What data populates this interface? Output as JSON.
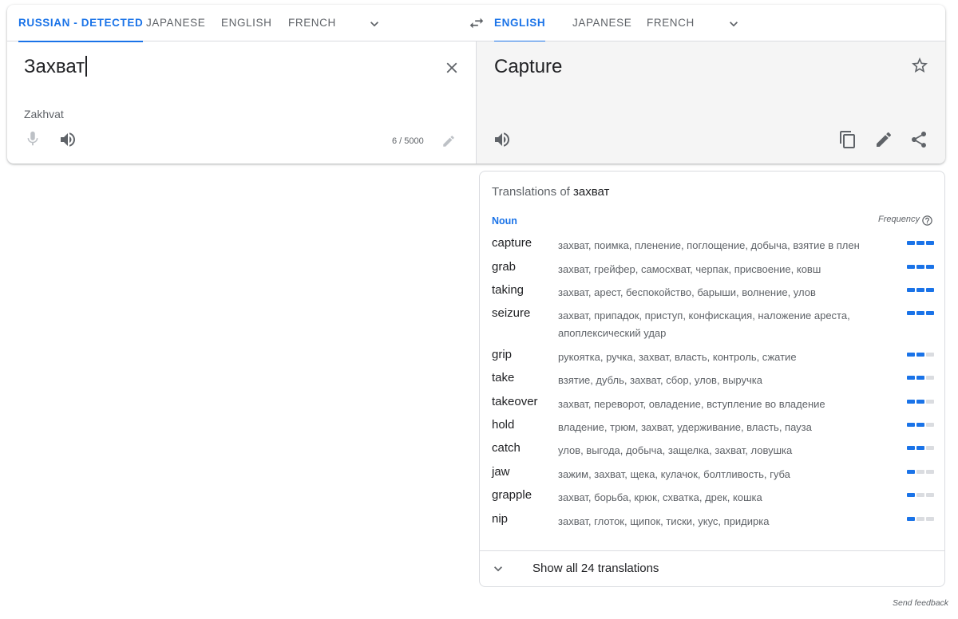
{
  "source_tabs": [
    {
      "label": "RUSSIAN - DETECTED",
      "active": true
    },
    {
      "label": "JAPANESE",
      "active": false
    },
    {
      "label": "ENGLISH",
      "active": false
    },
    {
      "label": "FRENCH",
      "active": false
    }
  ],
  "target_tabs": [
    {
      "label": "ENGLISH",
      "active": true
    },
    {
      "label": "JAPANESE",
      "active": false
    },
    {
      "label": "FRENCH",
      "active": false
    }
  ],
  "source": {
    "text": "Захват",
    "transliteration": "Zakhvat",
    "char_count": "6 / 5000"
  },
  "target": {
    "text": "Capture"
  },
  "translations": {
    "title_prefix": "Translations of",
    "title_word": "захват",
    "part_of_speech": "Noun",
    "frequency_label": "Frequency",
    "rows": [
      {
        "word": "capture",
        "synonyms": "захват, поимка, пленение, поглощение, добыча, взятие в плен",
        "frequency": 3
      },
      {
        "word": "grab",
        "synonyms": "захват, грейфер, самосхват, черпак, присвоение, ковш",
        "frequency": 3
      },
      {
        "word": "taking",
        "synonyms": "захват, арест, беспокойство, барыши, волнение, улов",
        "frequency": 3
      },
      {
        "word": "seizure",
        "synonyms": "захват, припадок, приступ, конфискация, наложение ареста, апоплексический удар",
        "frequency": 3
      },
      {
        "word": "grip",
        "synonyms": "рукоятка, ручка, захват, власть, контроль, сжатие",
        "frequency": 2
      },
      {
        "word": "take",
        "synonyms": "взятие, дубль, захват, сбор, улов, выручка",
        "frequency": 2
      },
      {
        "word": "takeover",
        "synonyms": "захват, переворот, овладение, вступление во владение",
        "frequency": 2
      },
      {
        "word": "hold",
        "synonyms": "владение, трюм, захват, удерживание, власть, пауза",
        "frequency": 2
      },
      {
        "word": "catch",
        "synonyms": "улов, выгода, добыча, защелка, захват, ловушка",
        "frequency": 2
      },
      {
        "word": "jaw",
        "synonyms": "зажим, захват, щека, кулачок, болтливость, губа",
        "frequency": 1
      },
      {
        "word": "grapple",
        "synonyms": "захват, борьба, крюк, схватка, дрек, кошка",
        "frequency": 1
      },
      {
        "word": "nip",
        "synonyms": "захват, глоток, щипок, тиски, укус, придирка",
        "frequency": 1
      }
    ],
    "show_all_label": "Show all 24 translations"
  },
  "footer": {
    "feedback_label": "Send feedback"
  },
  "colors": {
    "accent": "#1a73e8",
    "muted": "#5f6368",
    "target_bg": "#f5f5f5"
  },
  "icons": [
    "chevron-down-icon",
    "swap-icon",
    "close-icon",
    "mic-icon",
    "speaker-icon",
    "pencil-icon",
    "star-icon",
    "copy-icon",
    "share-icon",
    "help-icon"
  ]
}
